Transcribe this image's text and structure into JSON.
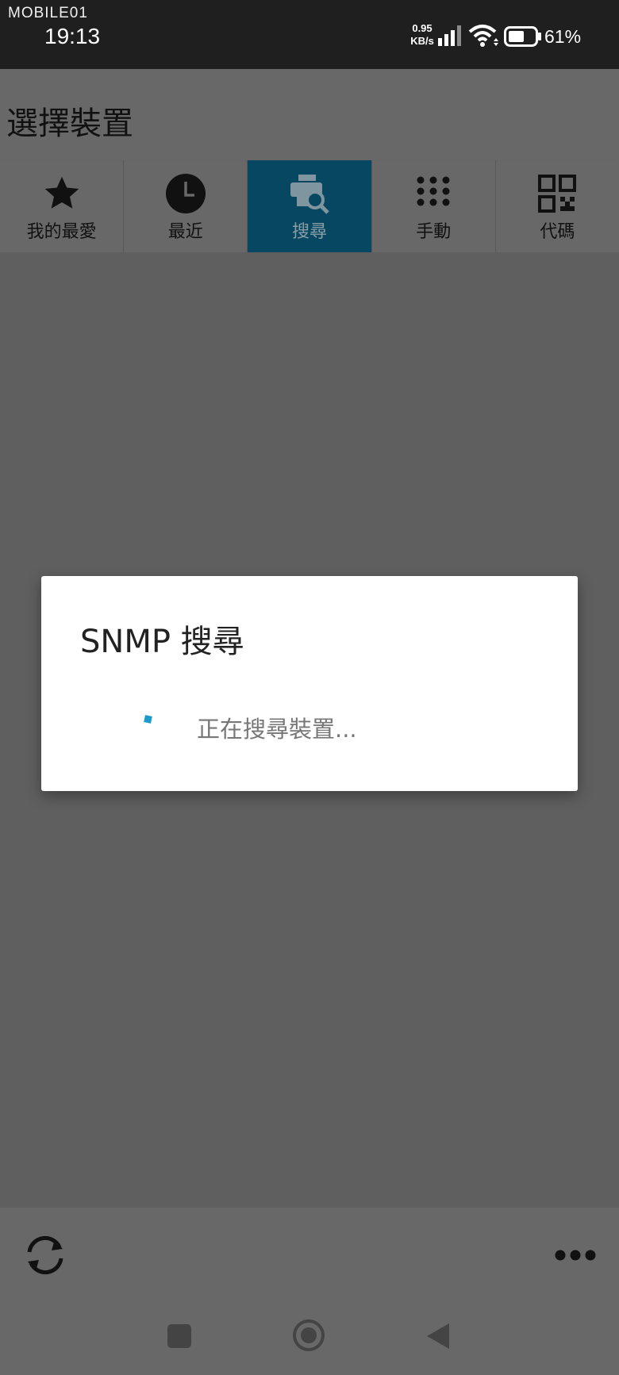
{
  "status_bar": {
    "watermark": "MOBILE01",
    "time": "19:13",
    "net_speed_value": "0.95",
    "net_speed_unit": "KB/s",
    "battery_percent": "61%",
    "battery_level": 0.61
  },
  "app_bar": {
    "title": "選擇裝置"
  },
  "tabs": [
    {
      "label": "我的最愛",
      "icon": "star-icon",
      "active": false
    },
    {
      "label": "最近",
      "icon": "clock-icon",
      "active": false
    },
    {
      "label": "搜尋",
      "icon": "printer-search-icon",
      "active": true
    },
    {
      "label": "手動",
      "icon": "dial-grid-icon",
      "active": false
    },
    {
      "label": "代碼",
      "icon": "qr-code-icon",
      "active": false
    }
  ],
  "dialog": {
    "title": "SNMP 搜尋",
    "message": "正在搜尋裝置...",
    "accent": "#1b9bc9"
  },
  "bottom_bar": {
    "left_icon": "refresh-icon",
    "right_icon": "more-icon"
  },
  "navigation": {
    "icons": [
      "recent-apps-icon",
      "home-icon",
      "back-icon"
    ]
  },
  "colors": {
    "active_tab": "#074761",
    "app_bar": "#686868",
    "status_bar": "#1f1f1f",
    "content_bg": "#5f5f5f"
  }
}
